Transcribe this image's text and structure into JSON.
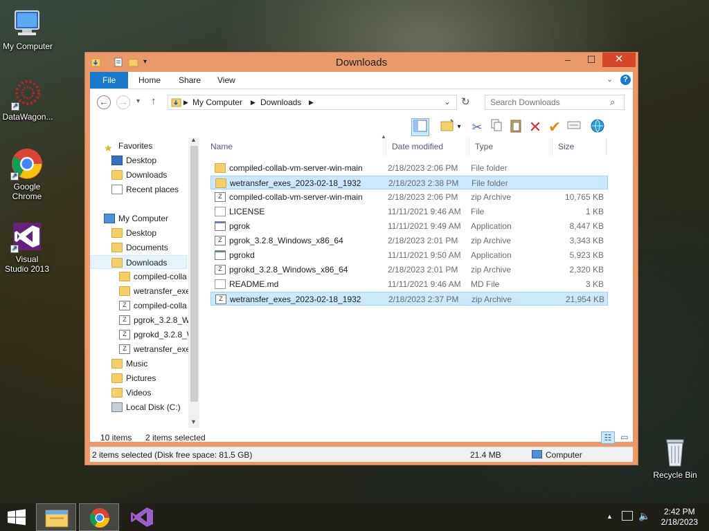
{
  "desktop": {
    "icons": [
      {
        "label": "My Computer"
      },
      {
        "label": "DataWagon..."
      },
      {
        "label": "Google Chrome"
      },
      {
        "label": "Visual Studio 2013"
      },
      {
        "label": "Recycle Bin"
      }
    ]
  },
  "window": {
    "title": "Downloads",
    "controls": {
      "minimize": "–",
      "maximize": "☐",
      "close": "✕"
    },
    "ribbon_tabs": [
      "File",
      "Home",
      "Share",
      "View"
    ],
    "address": {
      "crumbs": [
        "My Computer",
        "Downloads"
      ]
    },
    "search": {
      "placeholder": "Search Downloads"
    },
    "colors": {
      "accent": "#1979ca",
      "frame": "#ea9a6a",
      "selection": "#cce8ff",
      "close": "#d9472a"
    }
  },
  "nav": {
    "favorites_label": "Favorites",
    "favorites": [
      "Desktop",
      "Downloads",
      "Recent places"
    ],
    "computer_label": "My Computer",
    "computer": [
      "Desktop",
      "Documents",
      "Downloads"
    ],
    "downloads_children": [
      "compiled-colla",
      "wetransfer_exe",
      "compiled-colla",
      "pgrok_3.2.8_Wi",
      "pgrokd_3.2.8_W",
      "wetransfer_exe"
    ],
    "computer_rest": [
      "Music",
      "Pictures",
      "Videos",
      "Local Disk (C:)"
    ]
  },
  "columns": [
    "Name",
    "Date modified",
    "Type",
    "Size"
  ],
  "files": [
    {
      "name": "compiled-collab-vm-server-win-main",
      "date": "2/18/2023 2:06 PM",
      "type": "File folder",
      "size": "",
      "icon": "folder",
      "selected": false
    },
    {
      "name": "wetransfer_exes_2023-02-18_1932",
      "date": "2/18/2023 2:38 PM",
      "type": "File folder",
      "size": "",
      "icon": "folder",
      "selected": true
    },
    {
      "name": "compiled-collab-vm-server-win-main",
      "date": "2/18/2023 2:06 PM",
      "type": "zip Archive",
      "size": "10,765 KB",
      "icon": "zip",
      "selected": false
    },
    {
      "name": "LICENSE",
      "date": "11/11/2021 9:46 AM",
      "type": "File",
      "size": "1 KB",
      "icon": "plain",
      "selected": false
    },
    {
      "name": "pgrok",
      "date": "11/11/2021 9:49 AM",
      "type": "Application",
      "size": "8,447 KB",
      "icon": "app",
      "selected": false
    },
    {
      "name": "pgrok_3.2.8_Windows_x86_64",
      "date": "2/18/2023 2:01 PM",
      "type": "zip Archive",
      "size": "3,343 KB",
      "icon": "zip",
      "selected": false
    },
    {
      "name": "pgrokd",
      "date": "11/11/2021 9:50 AM",
      "type": "Application",
      "size": "5,923 KB",
      "icon": "app",
      "selected": false
    },
    {
      "name": "pgrokd_3.2.8_Windows_x86_64",
      "date": "2/18/2023 2:01 PM",
      "type": "zip Archive",
      "size": "2,320 KB",
      "icon": "zip",
      "selected": false
    },
    {
      "name": "README.md",
      "date": "11/11/2021 9:46 AM",
      "type": "MD File",
      "size": "3 KB",
      "icon": "plain",
      "selected": false
    },
    {
      "name": "wetransfer_exes_2023-02-18_1932",
      "date": "2/18/2023 2:37 PM",
      "type": "zip Archive",
      "size": "21,954 KB",
      "icon": "zip",
      "selected": true
    }
  ],
  "status": {
    "items": "10 items",
    "selected": "2 items selected",
    "bottom_left": "2 items selected (Disk free space: 81.5 GB)",
    "bottom_size": "21.4 MB",
    "bottom_location": "Computer"
  },
  "taskbar": {
    "time": "2:42 PM",
    "date": "2/18/2023"
  }
}
